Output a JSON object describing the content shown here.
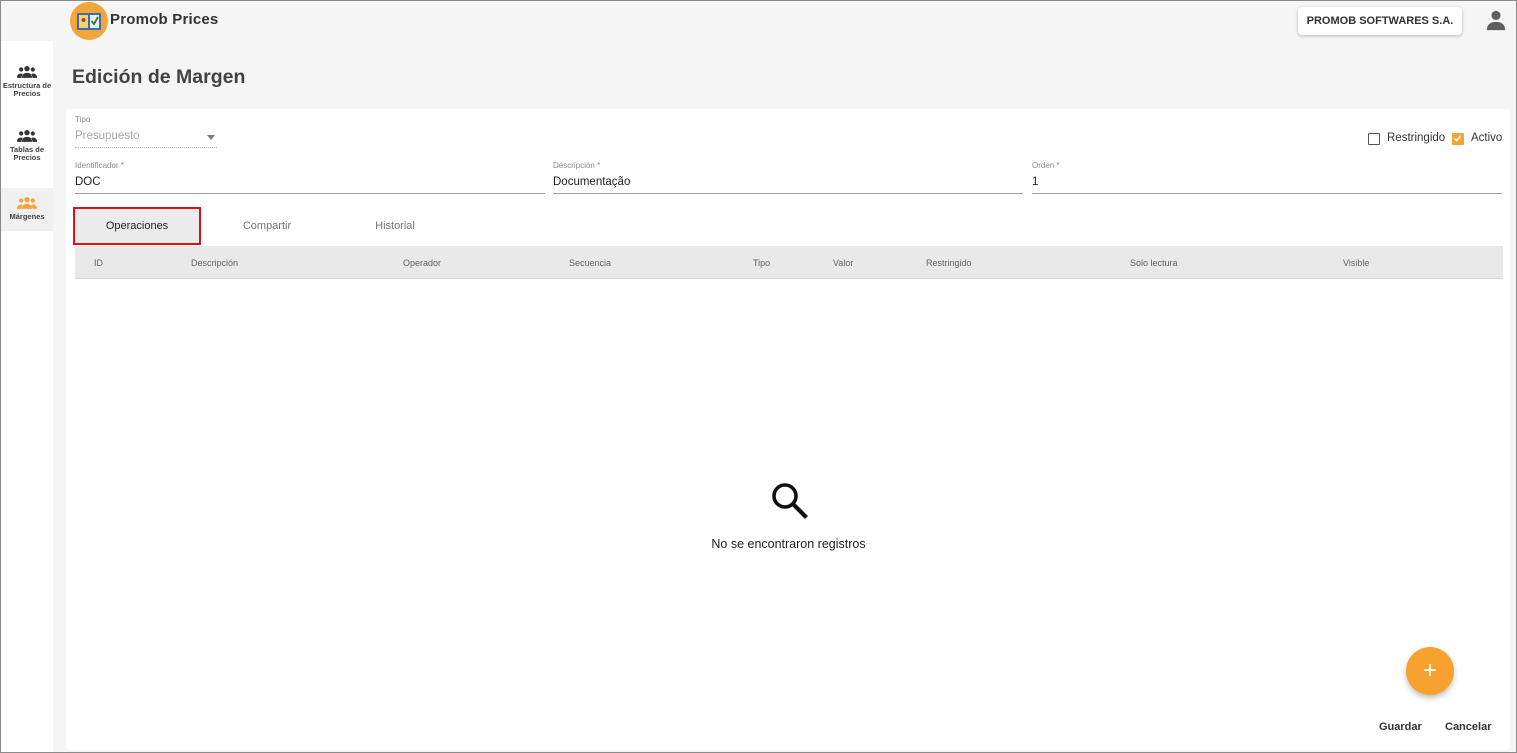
{
  "app": {
    "title": "Promob Prices"
  },
  "header": {
    "company": "PROMOB SOFTWARES S.A."
  },
  "sidebar": {
    "items": [
      {
        "label_line1": "Estructura de",
        "label_line2": "Precios"
      },
      {
        "label_line1": "Tablas de",
        "label_line2": "Precios"
      },
      {
        "label_line1": "Márgenes",
        "label_line2": ""
      }
    ]
  },
  "page": {
    "title": "Edición de Margen"
  },
  "form": {
    "tipo": {
      "label": "Tipo",
      "value": "Presupuesto"
    },
    "restringido": {
      "label": "Restringido",
      "checked": false
    },
    "activo": {
      "label": "Activo",
      "checked": true
    },
    "identificador": {
      "label": "Identificador *",
      "value": "DOC"
    },
    "descripcion": {
      "label": "Descripción *",
      "value": "Documentação"
    },
    "orden": {
      "label": "Orden *",
      "value": "1"
    }
  },
  "tabs": [
    {
      "label": "Operaciones",
      "active": true
    },
    {
      "label": "Compartir",
      "active": false
    },
    {
      "label": "Historial",
      "active": false
    }
  ],
  "table": {
    "columns": [
      "ID",
      "Descripción",
      "Operador",
      "Secuencia",
      "Tipo",
      "Valor",
      "Restringido",
      "Solo lectura",
      "Visible"
    ],
    "empty_message": "No se encontraron registros",
    "rows": []
  },
  "actions": {
    "add": "+",
    "save": "Guardar",
    "cancel": "Cancelar"
  },
  "colors": {
    "accent": "#f7a12e",
    "highlight": "#e0101b"
  }
}
